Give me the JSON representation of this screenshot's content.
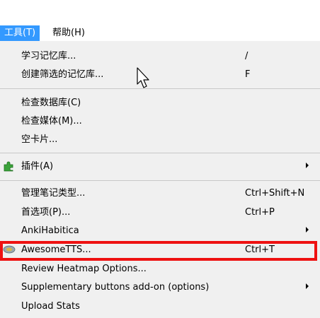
{
  "menubar": {
    "tools": "工具(T)",
    "help": "帮助(H)"
  },
  "menu": {
    "items": [
      {
        "label": "学习记忆库...",
        "shortcut": "/"
      },
      {
        "label": "创建筛选的记忆库...",
        "shortcut": "F"
      },
      {
        "label": "检查数据库(C)",
        "shortcut": ""
      },
      {
        "label": "检查媒体(M)...",
        "shortcut": ""
      },
      {
        "label": "空卡片...",
        "shortcut": ""
      },
      {
        "label": "插件(A)",
        "shortcut": ""
      },
      {
        "label": "管理笔记类型...",
        "shortcut": "Ctrl+Shift+N"
      },
      {
        "label": "首选项(P)...",
        "shortcut": "Ctrl+P"
      },
      {
        "label": "AnkiHabitica",
        "shortcut": ""
      },
      {
        "label": "AwesomeTTS...",
        "shortcut": "Ctrl+T"
      },
      {
        "label": "Review Heatmap Options...",
        "shortcut": ""
      },
      {
        "label": "Supplementary buttons add-on (options)",
        "shortcut": ""
      },
      {
        "label": "Upload Stats",
        "shortcut": ""
      }
    ]
  },
  "colors": {
    "active_menu": "#3399ff",
    "highlight_box": "#ee1111",
    "menu_bg": "#f0f0f0"
  },
  "icons": {
    "addons": "puzzle-piece-icon",
    "awesometts": "speaker-icon"
  }
}
